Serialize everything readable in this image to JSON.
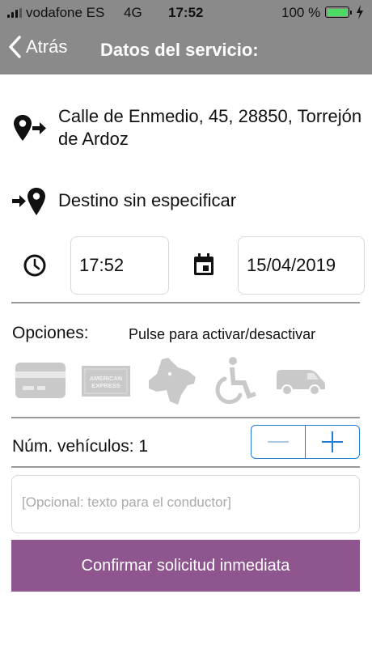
{
  "status_bar": {
    "carrier": "vodafone ES",
    "network": "4G",
    "time": "17:52",
    "battery_pct": "100 %",
    "battery_level": 1.0,
    "battery_color": "#4cd964"
  },
  "nav": {
    "back_label": "Atrás",
    "title": "Datos del servicio:",
    "bar_color": "#8a8a8a"
  },
  "origin": {
    "icon": "pickup-location-icon",
    "address": "Calle de Enmedio, 45, 28850, Torrejón de Ardoz"
  },
  "destination": {
    "icon": "dropoff-location-icon",
    "text": "Destino sin especificar"
  },
  "schedule": {
    "time_icon": "clock-icon",
    "time": "17:52",
    "date_icon": "calendar-icon",
    "date": "15/04/2019"
  },
  "options": {
    "label": "Opciones:",
    "hint": "Pulse para activar/desactivar",
    "items": [
      {
        "icon": "credit-card-icon",
        "active": false
      },
      {
        "icon": "american-express-icon",
        "active": false,
        "card_text": "AMERICAN EXPRESS"
      },
      {
        "icon": "dog-icon",
        "active": false
      },
      {
        "icon": "wheelchair-icon",
        "active": false
      },
      {
        "icon": "van-icon",
        "active": false
      }
    ]
  },
  "vehicles": {
    "label": "Núm. vehículos: 1",
    "decrement_symbol": "−",
    "increment_symbol": "+"
  },
  "note": {
    "placeholder": "[Opcional: texto para el conductor]"
  },
  "confirm": {
    "label": "Confirmar solicitud inmediata",
    "color": "#8e558f"
  }
}
